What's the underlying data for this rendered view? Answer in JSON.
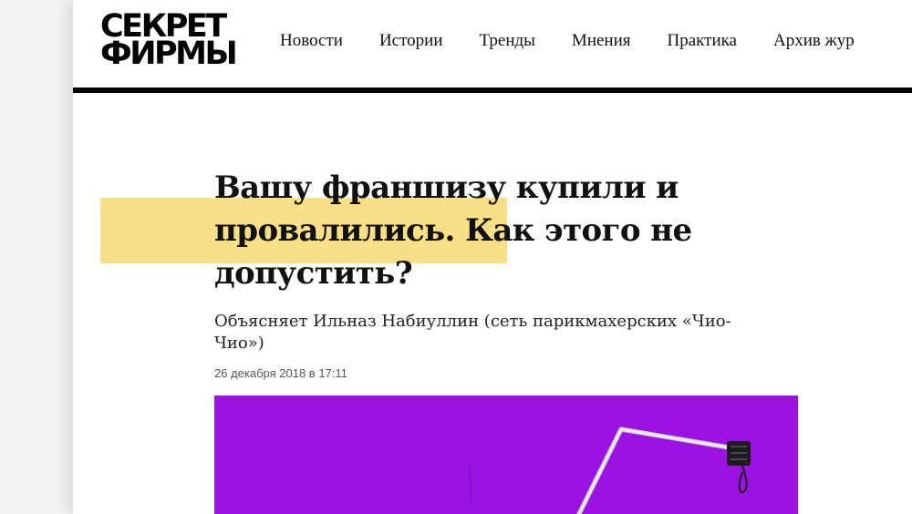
{
  "logo": {
    "line1": "СЕКРЕТ",
    "line2": "ФИРМЫ"
  },
  "nav": {
    "items": [
      {
        "label": "Новости"
      },
      {
        "label": "Истории"
      },
      {
        "label": "Тренды"
      },
      {
        "label": "Мнения"
      },
      {
        "label": "Практика"
      },
      {
        "label": "Архив жур"
      }
    ]
  },
  "article": {
    "headline": "Вашу франшизу купили и провалились. Как этого не допустить?",
    "subtitle": "Объясняет Ильназ Набиуллин (сеть парикмахерских «Чио-Чио»)",
    "date": "26 декабря 2018 в 17:11"
  },
  "colors": {
    "highlight": "#f9df87",
    "hero_background": "#9a13e0",
    "header_rule": "#000000"
  }
}
